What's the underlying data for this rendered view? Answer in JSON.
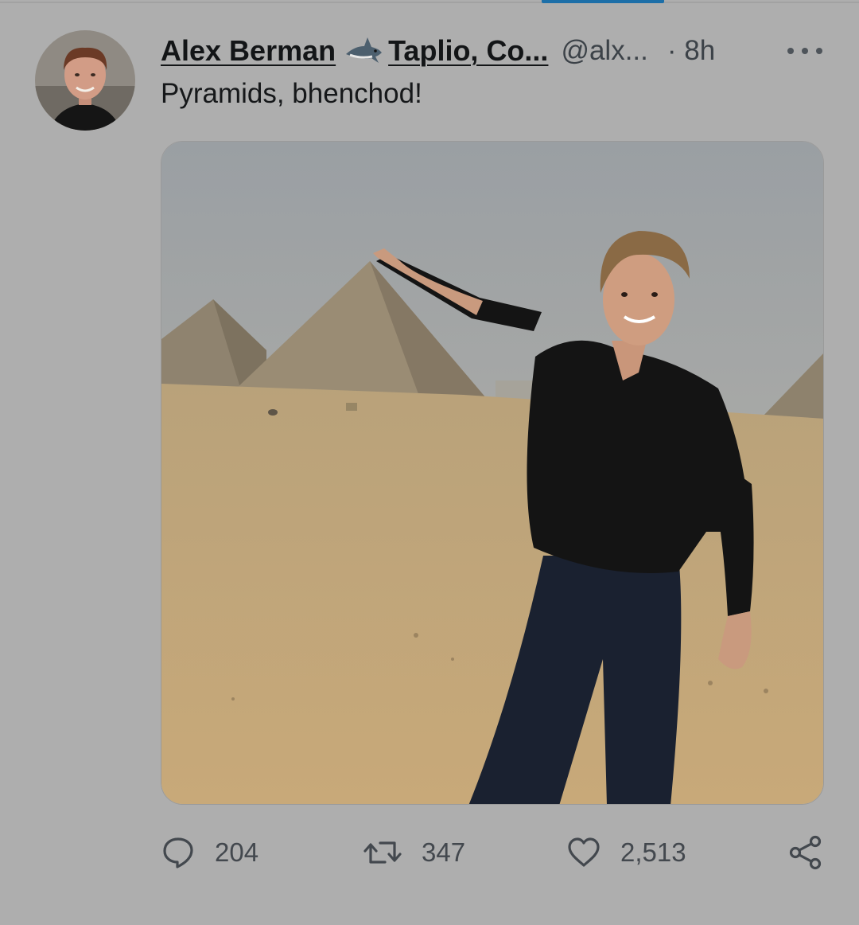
{
  "tweet": {
    "display_name_part1": "Alex Berman",
    "display_name_part2": "Taplio, Co...",
    "handle": "@alx...",
    "time": "· 8h",
    "text": "Pyramids, bhenchod!",
    "name_emoji_icon": "shark-icon"
  },
  "actions": {
    "reply_count": "204",
    "retweet_count": "347",
    "like_count": "2,513"
  },
  "icons": {
    "more": "more-horizontal-icon",
    "reply": "reply-icon",
    "retweet": "retweet-icon",
    "like": "heart-icon",
    "share": "share-icon"
  },
  "colors": {
    "background": "#aeaeae",
    "tab_indicator": "#1d6fa8",
    "text": "#151719",
    "secondary_text": "#43484e"
  }
}
